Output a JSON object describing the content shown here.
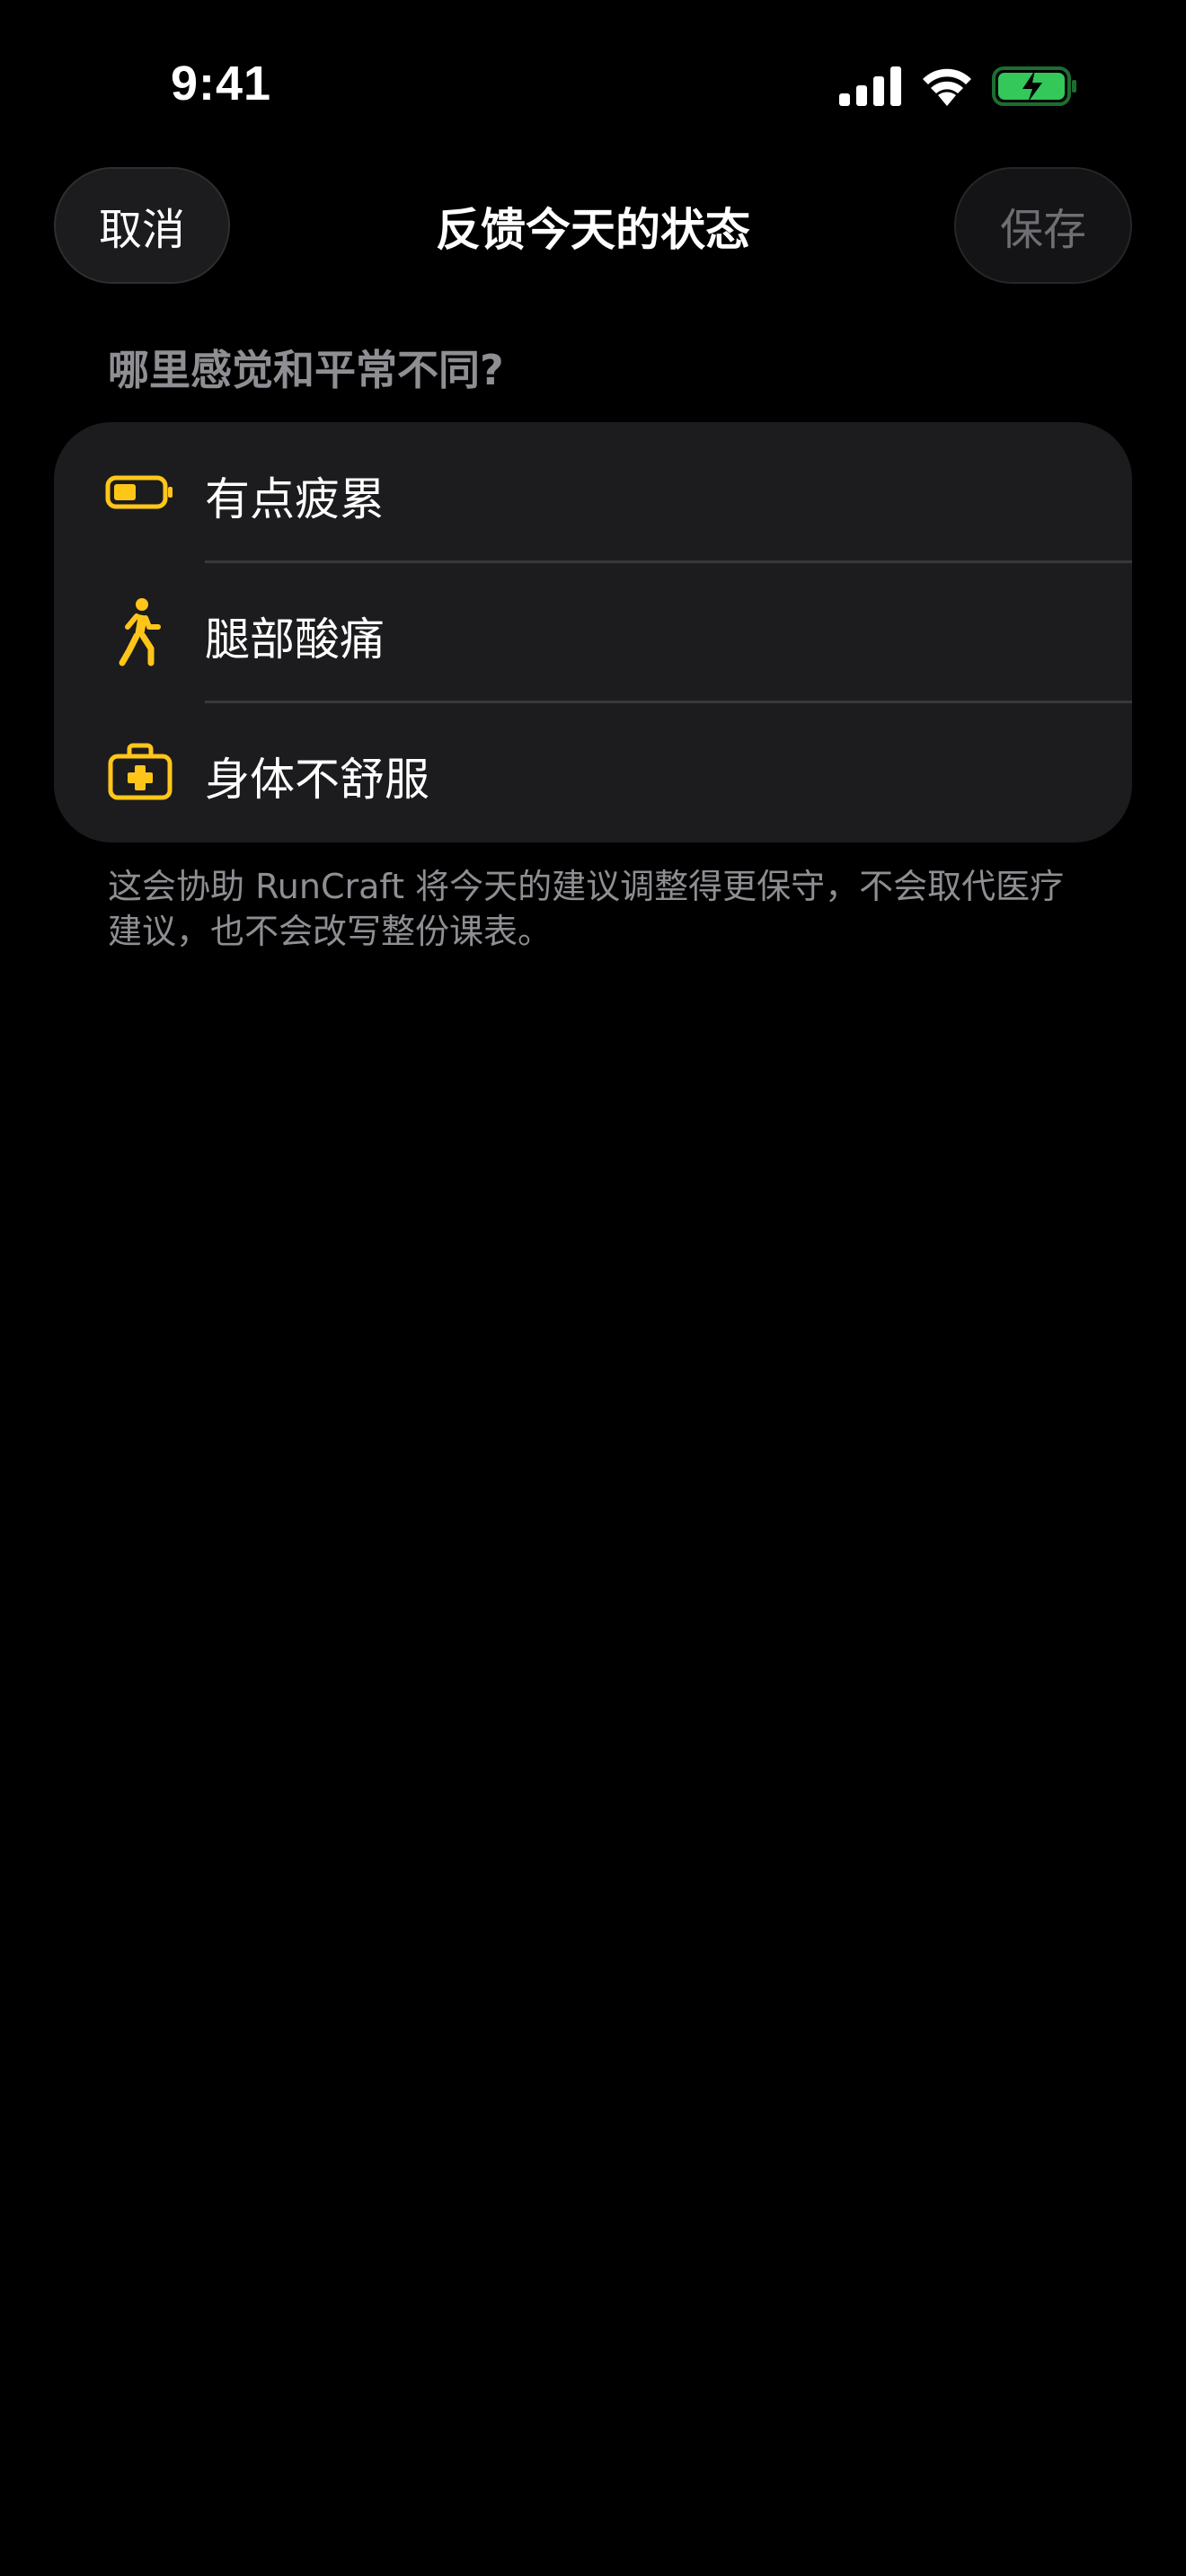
{
  "status_bar": {
    "time": "9:41"
  },
  "nav": {
    "cancel_label": "取消",
    "title": "反馈今天的状态",
    "save_label": "保存"
  },
  "section": {
    "header": "哪里感觉和平常不同?"
  },
  "options": [
    {
      "label": "有点疲累",
      "icon": "battery-low-icon"
    },
    {
      "label": "腿部酸痛",
      "icon": "runner-icon"
    },
    {
      "label": "身体不舒服",
      "icon": "medical-kit-icon"
    }
  ],
  "footnote": "这会协助 RunCraft 将今天的建议调整得更保守，不会取代医疗建议，也不会改写整份课表。",
  "colors": {
    "background": "#000000",
    "card": "#1c1c1e",
    "accent_icon": "#ffc619",
    "secondary_text": "#8e8e93",
    "battery_charging": "#34c759"
  }
}
